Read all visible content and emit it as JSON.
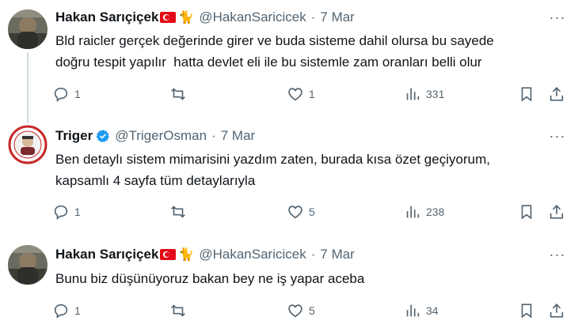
{
  "tweets": [
    {
      "name": "Hakan Sarıçiçek",
      "cat": "🐈",
      "handle": "@HakanSaricicek",
      "dot": "·",
      "date": "7 Mar",
      "lines": [
        "Bld raicler gerçek değerinde girer ve buda sisteme dahil olursa bu sayede",
        "doğru tespit yapılır  hatta devlet eli ile bu sistemle zam oranları belli olur"
      ],
      "replies": "1",
      "retweets": "",
      "likes": "1",
      "views": "331"
    },
    {
      "name": "Triger",
      "handle": "@TrigerOsman",
      "dot": "·",
      "date": "7 Mar",
      "lines": [
        "Ben detaylı sistem mimarisini yazdım zaten, burada kısa özet geçiyorum,",
        "kapsamlı 4 sayfa tüm detaylarıyla"
      ],
      "replies": "1",
      "retweets": "",
      "likes": "5",
      "views": "238"
    },
    {
      "name": "Hakan Sarıçiçek",
      "cat": "🐈",
      "handle": "@HakanSaricicek",
      "dot": "·",
      "date": "7 Mar",
      "lines": [
        "Bunu biz düşünüyoruz bakan bey ne iş yapar aceba"
      ],
      "replies": "1",
      "retweets": "",
      "likes": "5",
      "views": "34"
    }
  ],
  "more_label": "···",
  "colors": {
    "text": "#0f1419",
    "muted": "#536471",
    "verified": "#1d9bf0",
    "flag": "#e30a17"
  }
}
